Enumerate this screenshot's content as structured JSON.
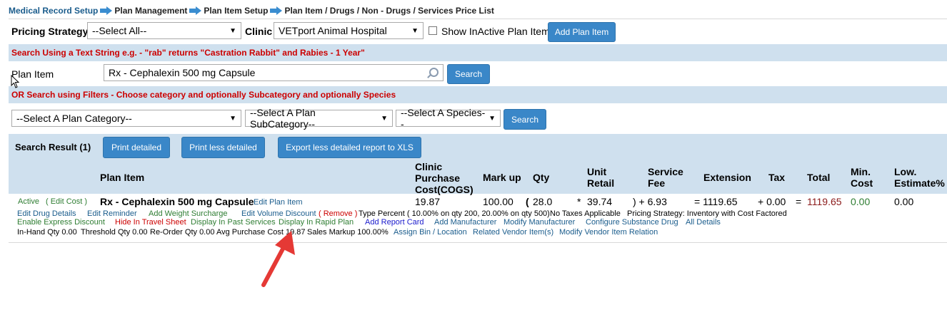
{
  "breadcrumb": {
    "items": [
      "Medical Record Setup",
      "Plan Management",
      "Plan Item Setup"
    ],
    "current": "Plan Item / Drugs / Non - Drugs / Services Price List"
  },
  "filters": {
    "pricing_strategy_label": "Pricing Strategy",
    "pricing_strategy_value": "--Select All--",
    "clinic_label": "Clinic",
    "clinic_value": "VETport Animal Hospital",
    "show_inactive_label": "Show InActive Plan Item",
    "add_plan_item_label": "Add Plan Item"
  },
  "search": {
    "text_hint": "Search Using a Text String e.g. - \"rab\" returns \"Castration Rabbit\" and Rabies - 1 Year\"",
    "plan_item_label": "Plan Item",
    "plan_item_value": "Rx - Cephalexin 500 mg Capsule",
    "search_label": "Search",
    "filter_hint": "OR Search using Filters - Choose category and optionally Subcategory and optionally Species",
    "category_value": "--Select A Plan Category--",
    "subcategory_value": "--Select A Plan SubCategory--",
    "species_value": "--Select A Species--",
    "search2_label": "Search"
  },
  "results": {
    "title": "Search Result (1)",
    "print_detailed": "Print detailed",
    "print_less": "Print less detailed",
    "export_xls": "Export less detailed report to XLS",
    "headers": {
      "plan_item": "Plan Item",
      "cogs": [
        "Clinic",
        "Purchase",
        "Cost(COGS)"
      ],
      "markup": "Mark up",
      "qty": "Qty",
      "unit_retail": [
        "Unit",
        "Retail"
      ],
      "service_fee": [
        "Service",
        "Fee"
      ],
      "extension": "Extension",
      "tax": "Tax",
      "total": "Total",
      "min_cost": [
        "Min.",
        "Cost"
      ],
      "low_estimate": [
        "Low.",
        "Estimate%"
      ]
    },
    "row": {
      "status": "Active",
      "edit_cost": "( Edit Cost )",
      "name": "Rx - Cephalexin 500 mg Capsule",
      "edit_plan_item": "Edit Plan Item",
      "cogs": "19.87",
      "markup": "100.00",
      "qty_open": "(",
      "qty": "28.0",
      "times": "*",
      "unit_retail": "39.74",
      "service_fee": ") + 6.93",
      "extension": "= 1119.65",
      "tax": "+  0.00",
      "equals": "=",
      "total": "1119.65",
      "min_cost": "0.00",
      "low_estimate": "0.00"
    },
    "detail_line1": {
      "edit_drug_details": "Edit Drug Details",
      "edit_reminder": "Edit Reminder",
      "add_weight_surcharge": "Add Weight Surcharge",
      "edit_volume_discount": "Edit Volume Discount",
      "remove": "( Remove )",
      "type_percent": "Type Percent ( 10.00% on qty 200,  20.00% on qty 500)",
      "no_taxes": "No Taxes Applicable",
      "pricing_strategy": "Pricing Strategy: Inventory with Cost Factored"
    },
    "detail_line2": {
      "enable_express_discount": "Enable Express Discount",
      "hide_in_travel_sheet": "Hide In Travel Sheet",
      "display_in_past_services": "Display In Past Services",
      "display_in_rapid_plan": "Display In Rapid Plan",
      "add_report_card": "Add Report Card",
      "add_manufacturer": "Add Manufacturer",
      "modify_manufacturer": "Modify Manufacturer",
      "configure_substance_drug": "Configure Substance Drug",
      "all_details": "All Details"
    },
    "detail_line3": {
      "in_hand_qty": "In-Hand Qty 0.00",
      "threshold_qty": "Threshold Qty 0.00",
      "reorder_qty": "Re-Order Qty 0.00",
      "avg_purchase_cost": "Avg Purchase Cost 19.87",
      "sales_markup": "Sales Markup 100.00%",
      "assign_bin": "Assign Bin / Location",
      "related_vendor": "Related Vendor Item(s)",
      "modify_vendor": "Modify Vendor Item Relation"
    }
  },
  "colors": {
    "accent": "#3a87c8",
    "band": "#cfe0ee",
    "hint_red": "#cc0000",
    "link_blue": "#1a5c8c",
    "annotation_arrow": "#e53935"
  }
}
